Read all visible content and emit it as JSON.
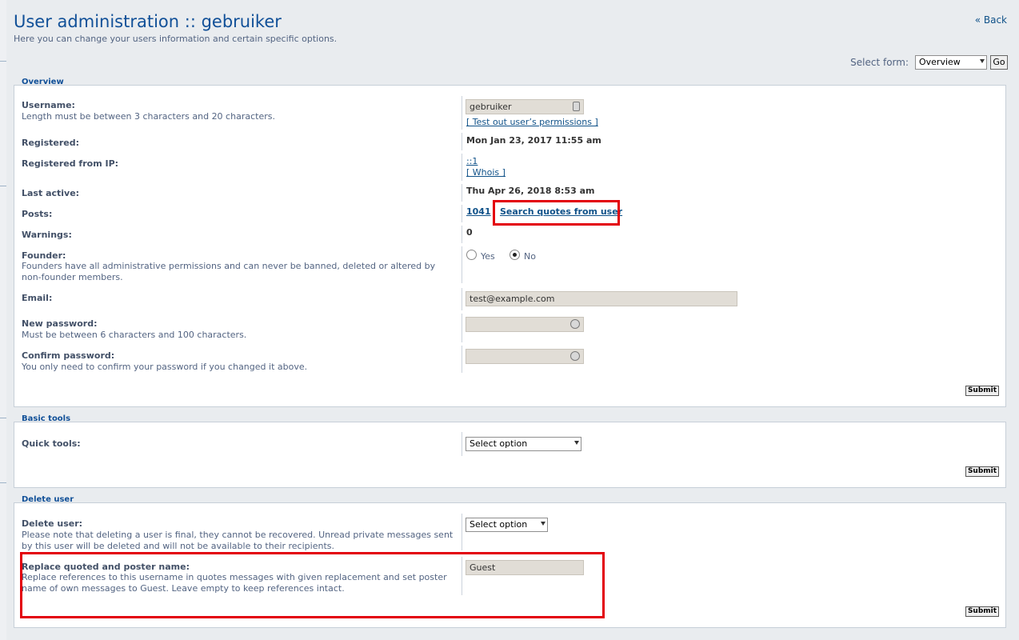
{
  "header": {
    "title": "User administration :: gebruiker",
    "description": "Here you can change your users information and certain specific options.",
    "back_link": "« Back",
    "select_form_label": "Select form:",
    "select_form_value": "Overview",
    "go_label": "Go"
  },
  "overview": {
    "legend": "Overview",
    "username": {
      "label": "Username:",
      "explain": "Length must be between 3 characters and 20 characters.",
      "value": "gebruiker",
      "permissions_link": "[ Test out user’s permissions ]"
    },
    "registered": {
      "label": "Registered:",
      "value": "Mon Jan 23, 2017 11:55 am"
    },
    "registered_ip": {
      "label": "Registered from IP:",
      "value": "::1",
      "whois_link": "[ Whois ]"
    },
    "last_active": {
      "label": "Last active:",
      "value": "Thu Apr 26, 2018 8:53 am"
    },
    "posts": {
      "label": "Posts:",
      "value": "1041",
      "search_link": "Search quotes from user"
    },
    "warnings": {
      "label": "Warnings:",
      "value": "0"
    },
    "founder": {
      "label": "Founder:",
      "explain": "Founders have all administrative permissions and can never be banned, deleted or altered by non-founder members.",
      "yes_label": "Yes",
      "no_label": "No",
      "selected": "No"
    },
    "email": {
      "label": "Email:",
      "value": "test@example.com"
    },
    "new_password": {
      "label": "New password:",
      "explain": "Must be between 6 characters and 100 characters.",
      "value": ""
    },
    "confirm_password": {
      "label": "Confirm password:",
      "explain": "You only need to confirm your password if you changed it above.",
      "value": ""
    },
    "submit_label": "Submit"
  },
  "basic_tools": {
    "legend": "Basic tools",
    "quick_tools": {
      "label": "Quick tools:",
      "value": "Select option"
    },
    "submit_label": "Submit"
  },
  "delete_user": {
    "legend": "Delete user",
    "delete": {
      "label": "Delete user:",
      "explain": "Please note that deleting a user is final, they cannot be recovered. Unread private messages sent by this user will be deleted and will not be available to their recipients.",
      "value": "Select option"
    },
    "replace": {
      "label": "Replace quoted and poster name:",
      "explain": "Replace references to this username in quotes messages with given replacement and set poster name of own messages to Guest. Leave empty to keep references intact.",
      "value": "Guest"
    },
    "submit_label": "Submit"
  },
  "colors": {
    "highlight": "#e3000b",
    "title": "#115098",
    "link": "#105289"
  }
}
